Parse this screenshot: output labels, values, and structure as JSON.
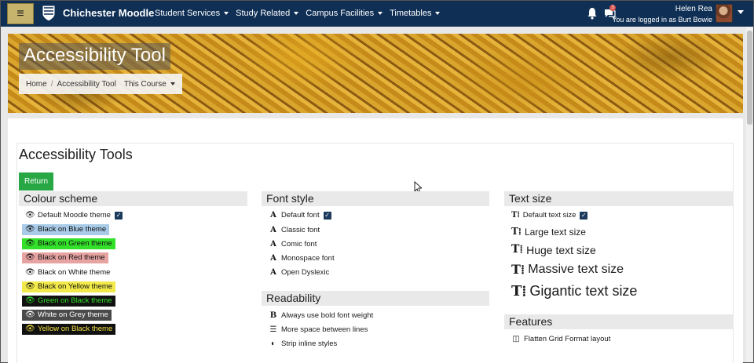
{
  "navbar": {
    "site_name": "Chichester Moodle",
    "menu": [
      "Student Services",
      "Study Related",
      "Campus Facilities",
      "Timetables"
    ],
    "message_count": "3",
    "user_name": "Helen Rea",
    "logged_in_as": "You are logged in as Burt Bowie"
  },
  "banner": {
    "title": "Accessibility Tool",
    "breadcrumb": [
      "Home",
      "Accessibility Tool",
      "This Course"
    ]
  },
  "main": {
    "heading": "Accessibility Tools",
    "return_label": "Return",
    "colour_scheme": {
      "title": "Colour scheme",
      "default": "Default Moodle theme",
      "themes": [
        {
          "label": "Black on Blue theme",
          "bg": "#a9cbe8",
          "fg": "#111111"
        },
        {
          "label": "Black on Green theme",
          "bg": "#33e02a",
          "fg": "#111111"
        },
        {
          "label": "Black on Red theme",
          "bg": "#e7a2a2",
          "fg": "#111111"
        },
        {
          "label": "Black on White theme",
          "bg": "#ffffff",
          "fg": "#111111"
        },
        {
          "label": "Black on Yellow theme",
          "bg": "#f2ea4a",
          "fg": "#111111"
        },
        {
          "label": "Green on Black theme",
          "bg": "#111111",
          "fg": "#33e02a"
        },
        {
          "label": "White on Grey theme",
          "bg": "#4a4a4a",
          "fg": "#ffffff"
        },
        {
          "label": "Yellow on Black theme",
          "bg": "#111111",
          "fg": "#f2e040"
        }
      ]
    },
    "font_style": {
      "title": "Font style",
      "options": [
        "Default font",
        "Classic font",
        "Comic font",
        "Monospace font",
        "Open Dyslexic"
      ]
    },
    "readability": {
      "title": "Readability",
      "options": [
        "Always use bold font weight",
        "More space between lines",
        "Strip inline styles"
      ]
    },
    "text_size": {
      "title": "Text size",
      "options": [
        "Default text size",
        "Large text size",
        "Huge text size",
        "Massive text size",
        "Gigantic text size"
      ]
    },
    "features": {
      "title": "Features",
      "options": [
        "Flatten Grid Format layout"
      ]
    }
  }
}
